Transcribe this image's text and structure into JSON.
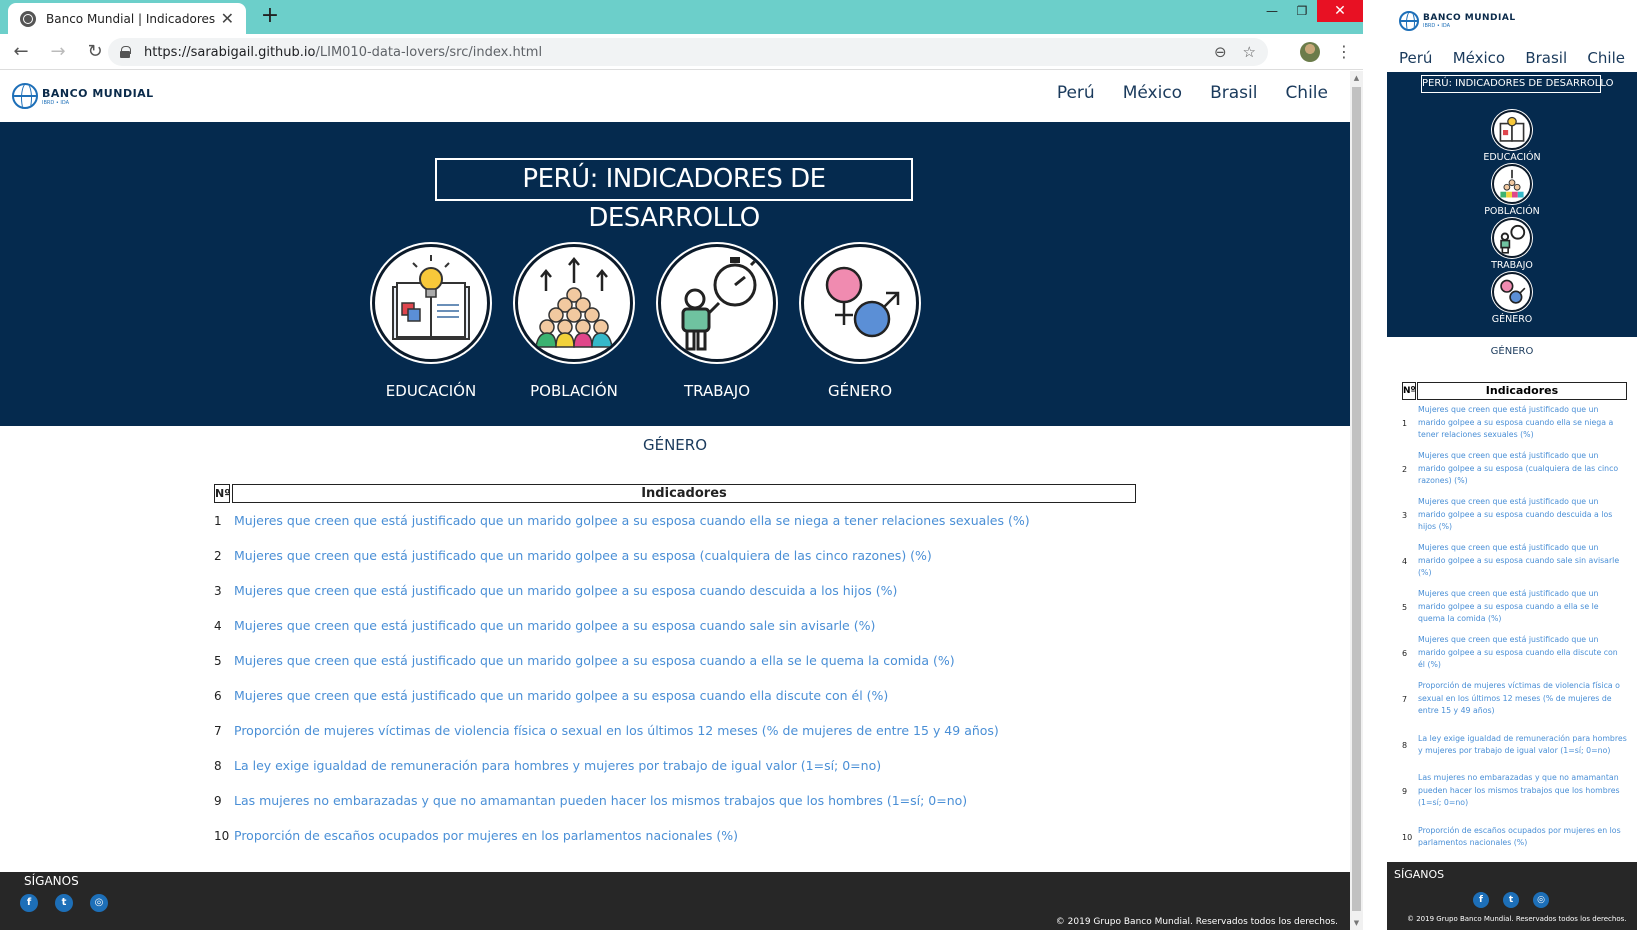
{
  "browser": {
    "tab_title": "Banco Mundial | Indicadores",
    "tab_close": "✕",
    "new_tab": "+",
    "url_host": "https://sarabigail.github.io",
    "url_path": "/LIM010-data-lovers/src/index.html",
    "back": "←",
    "forward": "→",
    "reload": "↻",
    "zoom_icon": "⊖",
    "star_icon": "☆",
    "menu": "⋮",
    "win_min": "—",
    "win_max": "❐",
    "win_close": "✕"
  },
  "logo": {
    "main": "BANCO  MUNDIAL",
    "sub": "IBRD • IDA"
  },
  "nav": {
    "peru": "Perú",
    "mexico": "México",
    "brasil": "Brasil",
    "chile": "Chile"
  },
  "hero": {
    "title": "PERÚ: INDICADORES DE DESARROLLO"
  },
  "categories": {
    "educacion": "EDUCACIÓN",
    "poblacion": "POBLACIÓN",
    "trabajo": "TRABAJO",
    "genero": "GÉNERO"
  },
  "section_title": "GÉNERO",
  "table": {
    "header_num": "Nº",
    "header_ind": "Indicadores",
    "rows": [
      {
        "num": "1",
        "text": "Mujeres que creen que está justificado que un marido golpee a su esposa cuando ella se niega a tener relaciones sexuales (%)"
      },
      {
        "num": "2",
        "text": "Mujeres que creen que está justificado que un marido golpee a su esposa (cualquiera de las cinco razones) (%)"
      },
      {
        "num": "3",
        "text": "Mujeres que creen que está justificado que un marido golpee a su esposa cuando descuida a los hijos (%)"
      },
      {
        "num": "4",
        "text": "Mujeres que creen que está justificado que un marido golpee a su esposa cuando sale sin avisarle (%)"
      },
      {
        "num": "5",
        "text": "Mujeres que creen que está justificado que un marido golpee a su esposa cuando a ella se le quema la comida (%)"
      },
      {
        "num": "6",
        "text": "Mujeres que creen que está justificado que un marido golpee a su esposa cuando ella discute con él (%)"
      },
      {
        "num": "7",
        "text": "Proporción de mujeres víctimas de violencia física o sexual en los últimos 12 meses (% de mujeres de entre 15 y 49 años)"
      },
      {
        "num": "8",
        "text": "La ley exige igualdad de remuneración para hombres y mujeres por trabajo de igual valor (1=sí; 0=no)"
      },
      {
        "num": "9",
        "text": "Las mujeres no embarazadas y que no amamantan pueden hacer los mismos trabajos que los hombres (1=sí; 0=no)"
      },
      {
        "num": "10",
        "text": "Proporción de escaños ocupados por mujeres en los parlamentos nacionales (%)"
      }
    ]
  },
  "footer": {
    "title": "SÍGANOS",
    "facebook": "f",
    "twitter": "t",
    "instagram": "◎",
    "copyright": "© 2019 Grupo Banco Mundial. Reservados todos los derechos."
  },
  "colors": {
    "navy": "#052a4e",
    "link": "#4a8fd6",
    "tabstrip": "#6ccfca",
    "footer": "#272727"
  }
}
